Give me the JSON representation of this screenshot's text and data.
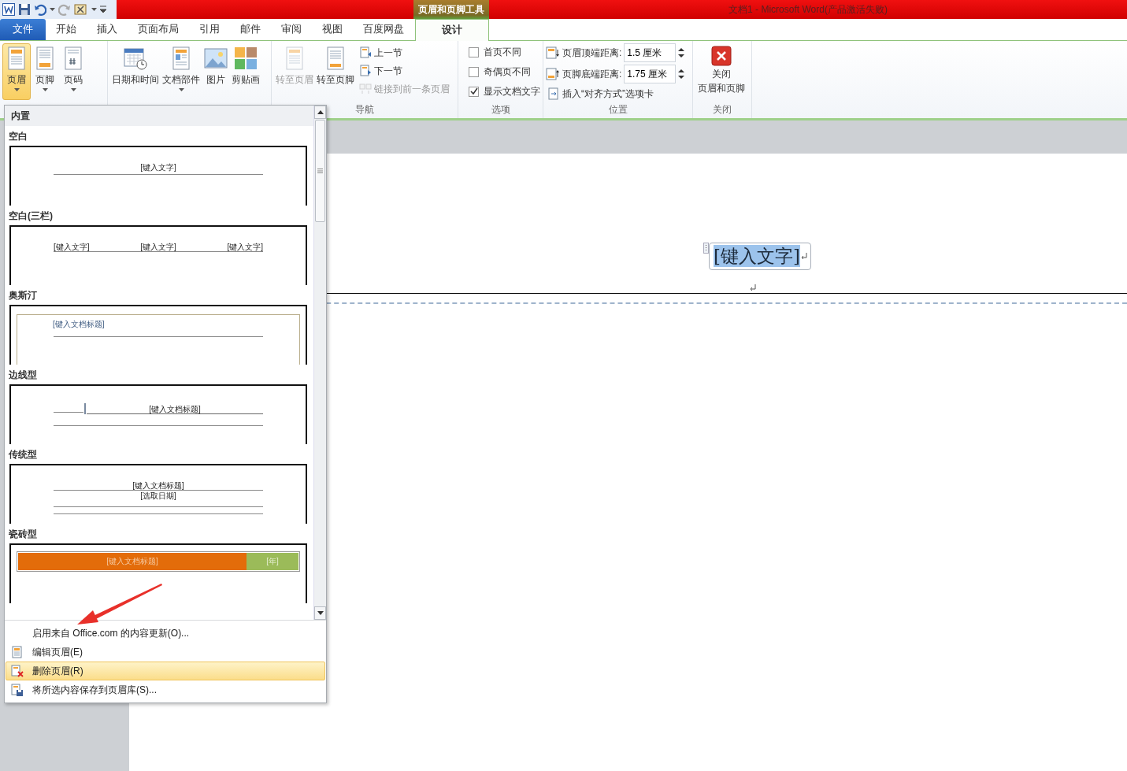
{
  "title_bar": {
    "context_label": "页眉和页脚工具",
    "title": "文档1 - Microsoft Word(产品激活失败)"
  },
  "tabs": [
    {
      "label": "文件",
      "kind": "file",
      "selected": false
    },
    {
      "label": "开始",
      "kind": "normal",
      "selected": false
    },
    {
      "label": "插入",
      "kind": "normal",
      "selected": false
    },
    {
      "label": "页面布局",
      "kind": "normal",
      "selected": false
    },
    {
      "label": "引用",
      "kind": "normal",
      "selected": false
    },
    {
      "label": "邮件",
      "kind": "normal",
      "selected": false
    },
    {
      "label": "审阅",
      "kind": "normal",
      "selected": false
    },
    {
      "label": "视图",
      "kind": "normal",
      "selected": false
    },
    {
      "label": "百度网盘",
      "kind": "normal",
      "selected": false
    },
    {
      "label": "设计",
      "kind": "context",
      "selected": true
    }
  ],
  "ribbon": {
    "groups": [
      {
        "items": [
          {
            "kind": "large",
            "label": "页眉",
            "dropdown": true,
            "pressed": true,
            "disabled": false
          },
          {
            "kind": "large",
            "label": "页脚",
            "dropdown": true,
            "pressed": false,
            "disabled": false
          },
          {
            "kind": "large",
            "label": "页码",
            "dropdown": true,
            "pressed": false,
            "disabled": false
          }
        ]
      },
      {
        "items": [
          {
            "kind": "large",
            "label": "日期和时间",
            "dropdown": false,
            "pressed": false,
            "disabled": false
          },
          {
            "kind": "large",
            "label": "文档部件",
            "dropdown": true,
            "pressed": false,
            "disabled": false
          },
          {
            "kind": "large",
            "label": "图片",
            "dropdown": false,
            "pressed": false,
            "disabled": false
          },
          {
            "kind": "large",
            "label": "剪贴画",
            "dropdown": false,
            "pressed": false,
            "disabled": false
          }
        ]
      },
      {
        "label": "导航",
        "items": [
          {
            "kind": "large",
            "label": "转至页眉",
            "dropdown": false,
            "pressed": false,
            "disabled": true
          },
          {
            "kind": "large",
            "label": "转至页脚",
            "dropdown": false,
            "pressed": false,
            "disabled": false
          },
          {
            "kind": "small",
            "label": "上一节",
            "disabled": false
          },
          {
            "kind": "small",
            "label": "下一节",
            "disabled": false
          },
          {
            "kind": "small",
            "label": "链接到前一条页眉",
            "disabled": true
          }
        ]
      },
      {
        "label": "选项",
        "items": [
          {
            "kind": "checkbox",
            "label": "首页不同",
            "checked": false
          },
          {
            "kind": "checkbox",
            "label": "奇偶页不同",
            "checked": false
          },
          {
            "kind": "checkbox",
            "label": "显示文档文字",
            "checked": true
          }
        ]
      },
      {
        "label": "位置",
        "items": [
          {
            "kind": "spinner",
            "label": "页眉顶端距离:",
            "value": "1.5 厘米"
          },
          {
            "kind": "spinner",
            "label": "页脚底端距离:",
            "value": "1.75 厘米"
          },
          {
            "kind": "small",
            "label": "插入“对齐方式”选项卡",
            "disabled": false
          }
        ]
      },
      {
        "label": "关闭",
        "items": [
          {
            "kind": "close",
            "lines": [
              "关闭",
              "页眉和页脚"
            ]
          }
        ]
      }
    ]
  },
  "header_menu": {
    "section": "内置",
    "gallery": [
      {
        "name": "空白",
        "kind": "blank",
        "texts": [
          "[键入文字]"
        ]
      },
      {
        "name": "空白(三栏)",
        "kind": "three",
        "texts": [
          "[键入文字]",
          "[键入文字]",
          "[键入文字]"
        ]
      },
      {
        "name": "奥斯汀",
        "kind": "austin",
        "texts": [
          "[键入文档标题]"
        ]
      },
      {
        "name": "边线型",
        "kind": "sideline",
        "texts": [
          "[键入文档标题]"
        ]
      },
      {
        "name": "传统型",
        "kind": "traditional",
        "texts": [
          "[键入文档标题]",
          "[选取日期]"
        ]
      },
      {
        "name": "瓷砖型",
        "kind": "tiles",
        "texts": [
          "[键入文档标题]",
          "[年]"
        ]
      }
    ],
    "commands": [
      {
        "label": "启用来自 Office.com 的内容更新(O)...",
        "selected": false
      },
      {
        "label": "编辑页眉(E)",
        "selected": false
      },
      {
        "label": "删除页眉(R)",
        "selected": true
      },
      {
        "label": "将所选内容保存到页眉库(S)...",
        "selected": false
      }
    ]
  },
  "document": {
    "header_text": "[键入文字]",
    "selected": true
  }
}
